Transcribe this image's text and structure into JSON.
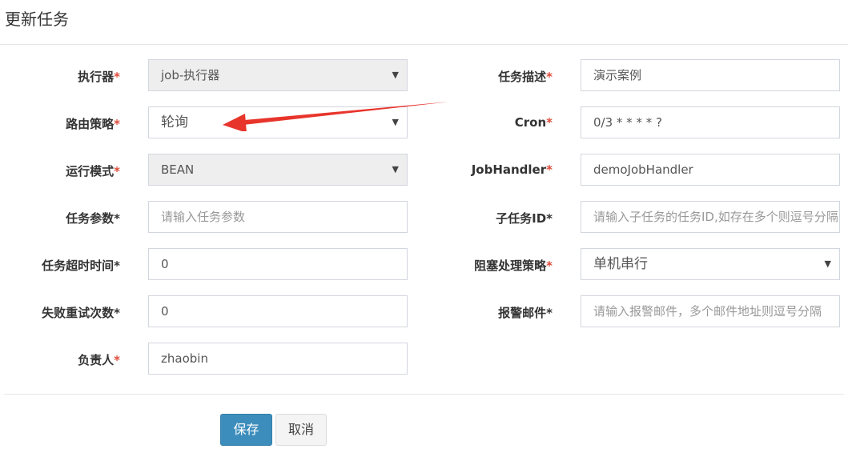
{
  "title": "更新任务",
  "required_mark": "*",
  "left": {
    "executor": {
      "label": "执行器",
      "value": "job-执行器"
    },
    "route": {
      "label": "路由策略",
      "value": "轮询"
    },
    "glue": {
      "label": "运行模式",
      "value": "BEAN"
    },
    "param": {
      "label": "任务参数*",
      "placeholder": "请输入任务参数"
    },
    "timeout": {
      "label": "任务超时时间*",
      "value": "0"
    },
    "retry": {
      "label": "失败重试次数*",
      "value": "0"
    },
    "author": {
      "label": "负责人",
      "value": "zhaobin"
    }
  },
  "right": {
    "desc": {
      "label": "任务描述",
      "value": "演示案例"
    },
    "cron": {
      "label": "Cron",
      "value": "0/3 * * * * ?"
    },
    "handler": {
      "label": "JobHandler",
      "value": "demoJobHandler"
    },
    "child": {
      "label": "子任务ID*",
      "placeholder": "请输入子任务的任务ID,如存在多个则逗号分隔"
    },
    "block": {
      "label": "阻塞处理策略",
      "value": "单机串行"
    },
    "alarm": {
      "label": "报警邮件*",
      "placeholder": "请输入报警邮件，多个邮件地址则逗号分隔"
    }
  },
  "buttons": {
    "save": "保存",
    "cancel": "取消"
  },
  "icons": {
    "caret": "caret-down-icon",
    "arrow": "red-annotation-arrow"
  },
  "colors": {
    "primary": "#3c8dbc",
    "required": "#dd4b39",
    "arrow": "#e8352c"
  }
}
